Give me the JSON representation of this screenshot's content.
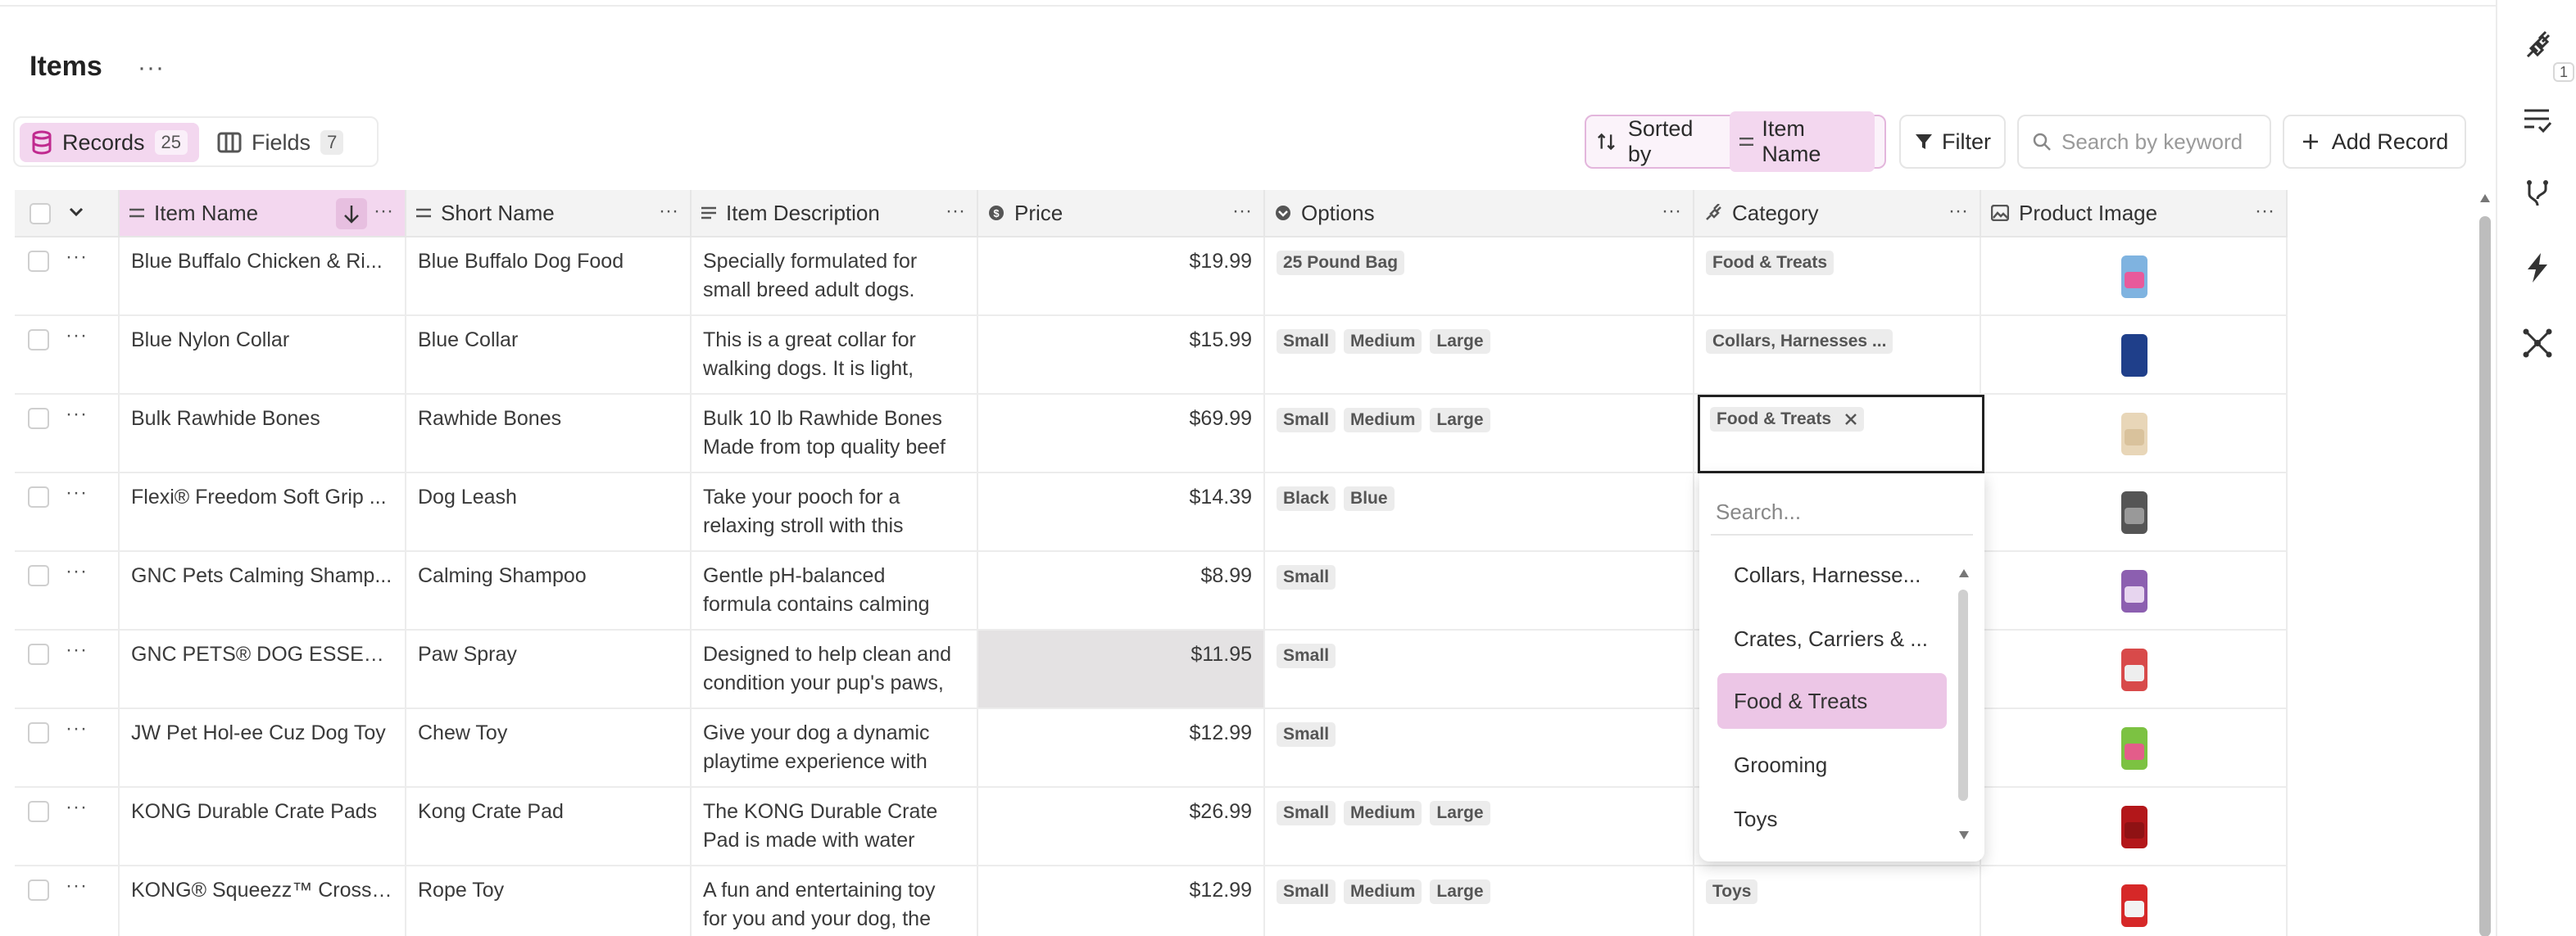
{
  "page_title": "Items",
  "title_more": "···",
  "tabs": [
    {
      "label": "Records",
      "count": "25"
    },
    {
      "label": "Fields",
      "count": "7"
    }
  ],
  "toolbar": {
    "sorted_by_label": "Sorted by",
    "sorted_field": "Item Name",
    "filter_label": "Filter",
    "search_placeholder": "Search by keyword",
    "add_record_label": "Add Record"
  },
  "rail": {
    "badge": "1"
  },
  "columns": [
    {
      "label": "Item Name"
    },
    {
      "label": "Short Name"
    },
    {
      "label": "Item Description"
    },
    {
      "label": "Price"
    },
    {
      "label": "Options"
    },
    {
      "label": "Category"
    },
    {
      "label": "Product Image"
    }
  ],
  "rows": [
    {
      "name": "Blue Buffalo Chicken & Ri...",
      "short": "Blue Buffalo Dog Food",
      "desc1": "Specially formulated for",
      "desc2": "small breed adult dogs.",
      "price": "$19.99",
      "options": [
        "25 Pound Bag"
      ],
      "category": "Food & Treats",
      "image": "dog-food-bag-icon"
    },
    {
      "name": "Blue Nylon Collar",
      "short": "Blue Collar",
      "desc1": "This is a great collar for",
      "desc2": "walking dogs.  It is light,",
      "price": "$15.99",
      "options": [
        "Small",
        "Medium",
        "Large"
      ],
      "category": "Collars, Harnesses ...",
      "image": "collar-icon"
    },
    {
      "name": "Bulk Rawhide Bones",
      "short": "Rawhide Bones",
      "desc1": "Bulk 10 lb Rawhide Bones",
      "desc2": "Made from top quality beef",
      "price": "$69.99",
      "options": [
        "Small",
        "Medium",
        "Large"
      ],
      "category": "Food & Treats",
      "image": "bones-icon"
    },
    {
      "name": "Flexi® Freedom Soft Grip ...",
      "short": "Dog Leash",
      "desc1": "Take your pooch for a",
      "desc2": "relaxing stroll with this",
      "price": "$14.39",
      "options": [
        "Black",
        "Blue"
      ],
      "category": "",
      "image": "leash-icon"
    },
    {
      "name": "GNC Pets Calming Shamp...",
      "short": "Calming Shampoo",
      "desc1": "Gentle pH-balanced",
      "desc2": "formula contains calming",
      "price": "$8.99",
      "options": [
        "Small"
      ],
      "category": "",
      "image": "shampoo-bottle-icon"
    },
    {
      "name": "GNC PETS® DOG ESSEN...",
      "short": "Paw Spray",
      "desc1": "Designed to help clean and",
      "desc2": "condition your pup's paws,",
      "price": "$11.95",
      "options": [
        "Small"
      ],
      "category": "",
      "image": "spray-bottle-icon"
    },
    {
      "name": "JW Pet Hol-ee Cuz Dog Toy",
      "short": "Chew Toy",
      "desc1": "Give your dog a dynamic",
      "desc2": "playtime experience with",
      "price": "$12.99",
      "options": [
        "Small"
      ],
      "category": "",
      "image": "chew-toy-icon"
    },
    {
      "name": "KONG Durable Crate Pads",
      "short": "Kong Crate Pad",
      "desc1": "The KONG Durable Crate",
      "desc2": "Pad is made with water",
      "price": "$26.99",
      "options": [
        "Small",
        "Medium",
        "Large"
      ],
      "category": "",
      "image": "crate-pad-icon"
    },
    {
      "name": "KONG® Squeezz™ Crosse...",
      "short": "Rope Toy",
      "desc1": "A fun and entertaining toy",
      "desc2": "for you and your dog, the",
      "price": "$12.99",
      "options": [
        "Small",
        "Medium",
        "Large"
      ],
      "category": "Toys",
      "image": "rope-toy-icon"
    }
  ],
  "editor": {
    "selected_tag": "Food & Treats",
    "search_placeholder": "Search...",
    "options": [
      "Collars, Harnesse...",
      "Crates, Carriers & ...",
      "Food & Treats",
      "Grooming",
      "Toys"
    ],
    "active_option": "Food & Treats"
  },
  "colors": {
    "accent": "#f3d7ef",
    "accent_border": "#e3b6dc",
    "highlight_cell": "#e4e2e3"
  }
}
